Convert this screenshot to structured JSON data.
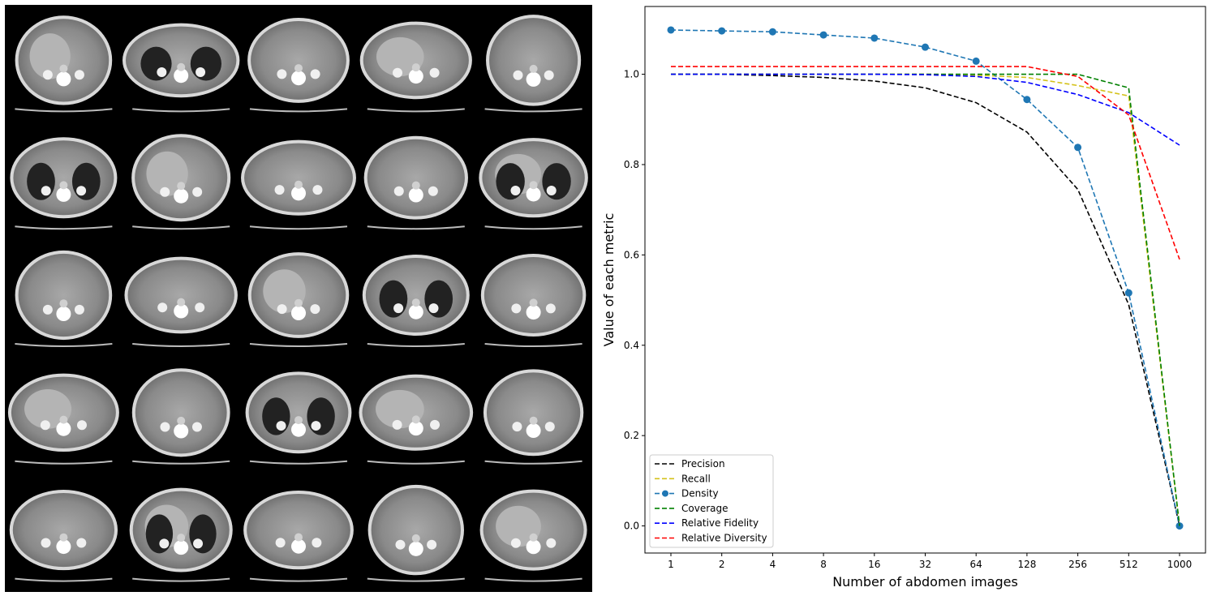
{
  "scan_grid": {
    "rows": 5,
    "cols": 5
  },
  "chart_data": {
    "type": "line",
    "x": [
      "1",
      "2",
      "4",
      "8",
      "16",
      "32",
      "64",
      "128",
      "256",
      "512",
      "1000"
    ],
    "xlabel": "Number of abdomen images",
    "ylabel": "Value of each metric",
    "ylim": [
      -0.06,
      1.15
    ],
    "yticks": [
      "0.0",
      "0.2",
      "0.4",
      "0.6",
      "0.8",
      "1.0"
    ],
    "grid": false,
    "legend_position": "lower-left",
    "series": [
      {
        "name": "Precision",
        "color": "#000000",
        "marker": "none",
        "values": [
          1.0,
          1.0,
          0.997,
          0.993,
          0.985,
          0.97,
          0.937,
          0.872,
          0.745,
          0.49,
          0.0
        ]
      },
      {
        "name": "Recall",
        "color": "#d4c21a",
        "marker": "none",
        "values": [
          1.0,
          1.0,
          1.0,
          1.0,
          1.0,
          1.0,
          0.998,
          0.993,
          0.975,
          0.952,
          0.0
        ]
      },
      {
        "name": "Density",
        "color": "#1f77b4",
        "marker": "circle",
        "values": [
          1.098,
          1.096,
          1.094,
          1.087,
          1.08,
          1.06,
          1.029,
          0.944,
          0.838,
          0.516,
          0.0
        ]
      },
      {
        "name": "Coverage",
        "color": "#008000",
        "marker": "none",
        "values": [
          1.0,
          1.0,
          1.0,
          1.0,
          1.0,
          1.0,
          1.0,
          1.0,
          1.0,
          0.97,
          0.0
        ]
      },
      {
        "name": "Relative Fidelity",
        "color": "#0000ff",
        "marker": "none",
        "values": [
          1.0,
          1.0,
          1.0,
          1.0,
          1.0,
          0.999,
          0.995,
          0.982,
          0.955,
          0.915,
          0.843
        ]
      },
      {
        "name": "Relative Diversity",
        "color": "#ff0000",
        "marker": "none",
        "values": [
          1.017,
          1.017,
          1.017,
          1.017,
          1.017,
          1.017,
          1.017,
          1.017,
          0.995,
          0.91,
          0.59
        ]
      }
    ]
  }
}
